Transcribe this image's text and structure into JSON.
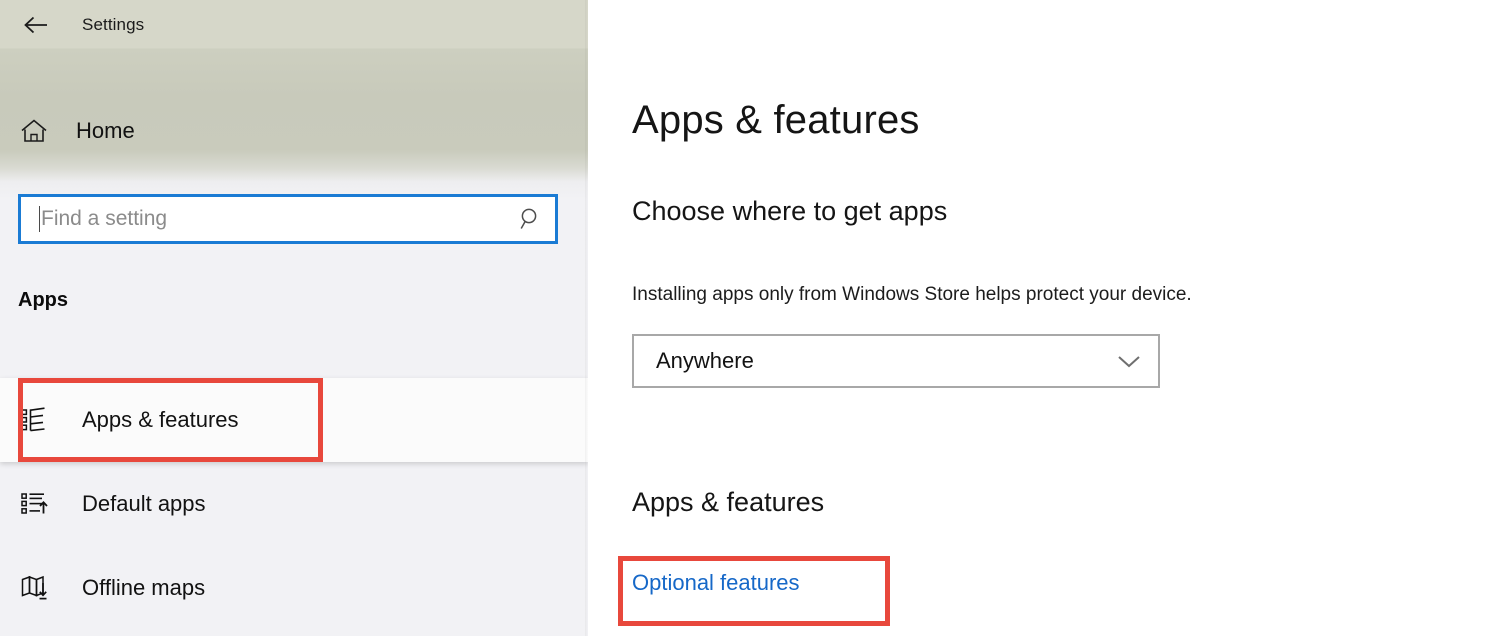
{
  "window": {
    "title": "Settings",
    "back_icon": "back-arrow-icon"
  },
  "sidebar": {
    "home": {
      "label": "Home",
      "icon": "home-icon"
    },
    "search": {
      "value": "",
      "placeholder": "Find a setting",
      "icon": "search-icon"
    },
    "section_header": "Apps",
    "items": [
      {
        "label": "Apps & features",
        "icon": "apps-list-icon",
        "selected": true,
        "highlighted": true
      },
      {
        "label": "Default apps",
        "icon": "default-apps-icon",
        "selected": false,
        "highlighted": false
      },
      {
        "label": "Offline maps",
        "icon": "offline-maps-icon",
        "selected": false,
        "highlighted": false
      }
    ]
  },
  "main": {
    "page_title": "Apps & features",
    "choose_section": {
      "title": "Choose where to get apps",
      "description": "Installing apps only from Windows Store helps protect your device.",
      "dropdown": {
        "selected": "Anywhere",
        "chevron_icon": "chevron-down-icon"
      }
    },
    "features_section": {
      "title": "Apps & features",
      "optional_features_link": "Optional features"
    }
  },
  "annotations": {
    "color": "#e8483c",
    "boxes": [
      {
        "target": "sidebar-item-apps-features"
      },
      {
        "target": "optional-features-link"
      }
    ]
  }
}
